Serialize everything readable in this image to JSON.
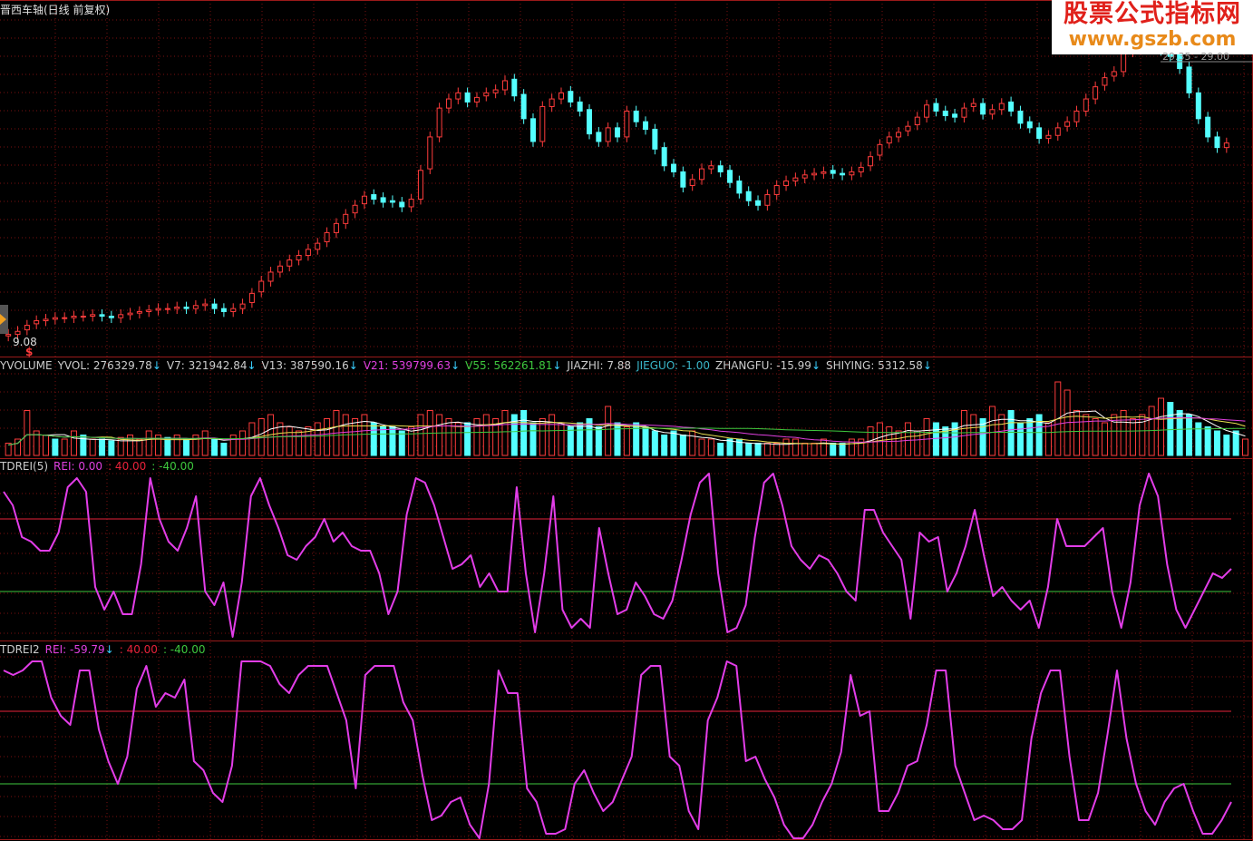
{
  "title": "晋西车轴(日线 前复权)",
  "watermark": {
    "line1": "股票公式指标网",
    "line2": "www.gszb.com"
  },
  "price_low_label": "9.08",
  "price_high_label": "29.35 - 29.00",
  "marker_label": "$",
  "colors": {
    "up": "#ff3c3c",
    "down": "#54ffff",
    "rei": "#e23de8",
    "upper": "#e8223a",
    "lower": "#3ec83e",
    "grid": "#7a1010"
  },
  "volume_header": [
    {
      "text": "YVOLUME",
      "color": "#cccccc"
    },
    {
      "text": "YVOL: 276329.78",
      "color": "#cccccc",
      "arrow": true
    },
    {
      "text": "V7: 321942.84",
      "color": "#cccccc",
      "arrow": true
    },
    {
      "text": "V13: 387590.16",
      "color": "#cccccc",
      "arrow": true
    },
    {
      "text": "V21: 539799.63",
      "color": "#e040e0",
      "arrow": true
    },
    {
      "text": "V55: 562261.81",
      "color": "#3ec83e",
      "arrow": true
    },
    {
      "text": "JIAZHI: 7.88",
      "color": "#cccccc",
      "arrow": false
    },
    {
      "text": "JIEGUO: -1.00",
      "color": "#3ab5c8",
      "arrow": false
    },
    {
      "text": "ZHANGFU: -15.99",
      "color": "#cccccc",
      "arrow": true
    },
    {
      "text": "SHIYING: 5312.58",
      "color": "#cccccc",
      "arrow": true
    }
  ],
  "tdrei_header": [
    {
      "text": "TDREI(5)",
      "color": "#cccccc"
    },
    {
      "text": "REI: 0.00",
      "color": "#e040e0"
    },
    {
      "text": ": 40.00",
      "color": "#e8223a"
    },
    {
      "text": ": -40.00",
      "color": "#3ec83e"
    }
  ],
  "tdrei2_header": [
    {
      "text": "TDREI2",
      "color": "#cccccc"
    },
    {
      "text": "REI: -59.79",
      "color": "#e040e0",
      "arrow": true
    },
    {
      "text": ": 40.00",
      "color": "#e8223a"
    },
    {
      "text": ": -40.00",
      "color": "#3ec83e"
    }
  ],
  "chart_data": [
    {
      "type": "candlestick",
      "name": "price",
      "ylim": [
        8.5,
        30
      ],
      "close": [
        9.3,
        9.5,
        9.9,
        10.2,
        10.3,
        10.4,
        10.4,
        10.5,
        10.5,
        10.6,
        10.5,
        10.4,
        10.6,
        10.7,
        10.8,
        10.9,
        11.0,
        11.0,
        11.1,
        11.0,
        11.2,
        11.3,
        11.0,
        10.8,
        11.0,
        11.3,
        12.0,
        12.8,
        13.4,
        13.8,
        14.2,
        14.5,
        14.9,
        15.3,
        16.0,
        16.6,
        17.2,
        17.8,
        18.4,
        18.2,
        18.0,
        18.0,
        17.7,
        18.2,
        20.1,
        22.3,
        24.2,
        24.8,
        25.2,
        24.6,
        24.9,
        25.2,
        25.4,
        26.0,
        25.0,
        23.5,
        22.0,
        24.3,
        24.8,
        25.2,
        24.6,
        24.0,
        22.5,
        22.0,
        22.9,
        22.3,
        24.0,
        23.3,
        22.8,
        21.5,
        20.4,
        20.0,
        19.0,
        19.5,
        20.2,
        20.4,
        20.0,
        19.3,
        18.6,
        18.1,
        17.8,
        18.5,
        19.1,
        19.4,
        19.6,
        19.8,
        19.9,
        20.0,
        19.9,
        19.8,
        20.0,
        20.3,
        21.0,
        21.8,
        22.3,
        22.6,
        23.0,
        23.6,
        24.4,
        24.0,
        23.7,
        23.6,
        24.2,
        24.5,
        23.8,
        24.1,
        24.5,
        24.0,
        23.2,
        22.9,
        22.2,
        22.4,
        22.9,
        23.3,
        24.0,
        24.8,
        25.6,
        26.2,
        26.6,
        27.8,
        28.3,
        28.7,
        28.4,
        28.0,
        27.6,
        26.8,
        25.2,
        23.5,
        22.3,
        21.6,
        21.9
      ],
      "open": [
        9.2,
        9.3,
        9.6,
        10.0,
        10.2,
        10.3,
        10.4,
        10.4,
        10.5,
        10.5,
        10.6,
        10.5,
        10.4,
        10.6,
        10.7,
        10.8,
        10.9,
        11.0,
        11.0,
        11.1,
        11.0,
        11.2,
        11.3,
        11.0,
        10.8,
        11.0,
        11.4,
        12.1,
        12.8,
        13.4,
        13.8,
        14.2,
        14.5,
        14.9,
        15.4,
        16.0,
        16.6,
        17.3,
        17.9,
        18.5,
        18.3,
        18.1,
        18.0,
        17.7,
        18.2,
        20.2,
        22.3,
        24.2,
        24.8,
        25.2,
        24.6,
        25.0,
        25.2,
        25.4,
        26.1,
        25.1,
        23.5,
        22.0,
        24.3,
        24.8,
        25.3,
        24.6,
        24.1,
        22.6,
        22.0,
        22.9,
        22.3,
        24.0,
        23.3,
        22.8,
        21.6,
        20.5,
        20.0,
        19.1,
        19.5,
        20.2,
        20.4,
        20.1,
        19.4,
        18.7,
        18.1,
        17.8,
        18.5,
        19.1,
        19.4,
        19.6,
        19.8,
        19.9,
        20.1,
        19.9,
        19.8,
        20.0,
        20.4,
        21.1,
        21.9,
        22.3,
        22.7,
        23.1,
        23.6,
        24.5,
        24.0,
        23.8,
        23.6,
        24.3,
        24.5,
        23.8,
        24.1,
        24.6,
        24.0,
        23.3,
        22.9,
        22.2,
        22.4,
        23.0,
        23.3,
        24.0,
        24.8,
        25.7,
        26.3,
        26.6,
        27.9,
        28.4,
        28.8,
        28.4,
        28.1,
        27.7,
        26.9,
        25.2,
        23.6,
        22.3,
        21.6
      ]
    },
    {
      "type": "bar",
      "name": "volume",
      "ylim": [
        0,
        1
      ],
      "values": [
        0.15,
        0.2,
        0.55,
        0.3,
        0.25,
        0.2,
        0.2,
        0.3,
        0.25,
        0.2,
        0.2,
        0.18,
        0.22,
        0.25,
        0.2,
        0.3,
        0.25,
        0.22,
        0.25,
        0.2,
        0.25,
        0.3,
        0.2,
        0.15,
        0.25,
        0.3,
        0.4,
        0.45,
        0.5,
        0.4,
        0.35,
        0.3,
        0.35,
        0.4,
        0.45,
        0.55,
        0.5,
        0.45,
        0.5,
        0.4,
        0.35,
        0.35,
        0.3,
        0.35,
        0.5,
        0.55,
        0.5,
        0.45,
        0.4,
        0.4,
        0.45,
        0.5,
        0.45,
        0.55,
        0.5,
        0.55,
        0.4,
        0.45,
        0.5,
        0.4,
        0.35,
        0.4,
        0.45,
        0.35,
        0.6,
        0.4,
        0.35,
        0.4,
        0.35,
        0.3,
        0.25,
        0.3,
        0.25,
        0.3,
        0.2,
        0.2,
        0.15,
        0.2,
        0.2,
        0.15,
        0.15,
        0.15,
        0.15,
        0.2,
        0.2,
        0.15,
        0.15,
        0.2,
        0.15,
        0.15,
        0.2,
        0.2,
        0.35,
        0.4,
        0.35,
        0.3,
        0.4,
        0.3,
        0.45,
        0.4,
        0.35,
        0.4,
        0.55,
        0.5,
        0.45,
        0.6,
        0.5,
        0.55,
        0.4,
        0.45,
        0.5,
        0.4,
        0.9,
        0.8,
        0.55,
        0.5,
        0.45,
        0.4,
        0.5,
        0.55,
        0.45,
        0.5,
        0.6,
        0.7,
        0.65,
        0.55,
        0.5,
        0.4,
        0.35,
        0.3,
        0.25,
        0.3,
        0.2
      ],
      "up": [
        true,
        true,
        true,
        true,
        true,
        false,
        true,
        true,
        false,
        true,
        false,
        false,
        true,
        true,
        true,
        true,
        true,
        false,
        true,
        false,
        true,
        true,
        false,
        false,
        true,
        true,
        true,
        true,
        true,
        true,
        true,
        true,
        true,
        true,
        true,
        true,
        true,
        true,
        true,
        false,
        false,
        false,
        false,
        true,
        true,
        true,
        true,
        true,
        true,
        false,
        true,
        true,
        true,
        true,
        false,
        false,
        false,
        true,
        true,
        true,
        false,
        false,
        false,
        false,
        true,
        false,
        true,
        false,
        false,
        false,
        false,
        false,
        false,
        true,
        true,
        true,
        false,
        false,
        false,
        false,
        false,
        true,
        true,
        true,
        true,
        true,
        true,
        true,
        false,
        false,
        true,
        true,
        true,
        true,
        true,
        true,
        true,
        true,
        true,
        false,
        false,
        false,
        true,
        true,
        false,
        true,
        true,
        false,
        false,
        false,
        false,
        true,
        true,
        true,
        true,
        true,
        true,
        true,
        true,
        true,
        true,
        true,
        true,
        true,
        false,
        false,
        false,
        false,
        false,
        false,
        false,
        false,
        true
      ]
    },
    {
      "type": "line",
      "name": "TDREI(5)",
      "ylim": [
        -90,
        90
      ],
      "reference_lines": [
        40,
        -40
      ],
      "values": [
        70,
        55,
        20,
        15,
        5,
        5,
        25,
        75,
        85,
        70,
        -35,
        -60,
        -40,
        -65,
        -65,
        -10,
        85,
        40,
        15,
        5,
        30,
        65,
        -40,
        -55,
        -30,
        -90,
        -30,
        65,
        85,
        55,
        30,
        0,
        -5,
        10,
        20,
        40,
        15,
        25,
        10,
        5,
        5,
        -20,
        -65,
        -40,
        45,
        85,
        80,
        55,
        20,
        -15,
        -10,
        0,
        -35,
        -20,
        -40,
        -40,
        75,
        -20,
        -85,
        -20,
        65,
        -60,
        -80,
        -70,
        -80,
        30,
        -20,
        -65,
        -60,
        -30,
        -45,
        -65,
        -70,
        -50,
        -5,
        45,
        80,
        90,
        -20,
        -85,
        -80,
        -55,
        20,
        80,
        90,
        55,
        10,
        -5,
        -15,
        0,
        -5,
        -20,
        -40,
        -50,
        50,
        50,
        25,
        10,
        -5,
        -70,
        25,
        15,
        20,
        -40,
        -20,
        10,
        50,
        0,
        -45,
        -35,
        -50,
        -60,
        -50,
        -80,
        -35,
        40,
        10,
        10,
        10,
        20,
        30,
        -40,
        -80,
        -30,
        55,
        90,
        65,
        -10,
        -60,
        -80,
        -60,
        -40,
        -20,
        -25,
        -15
      ]
    },
    {
      "type": "line",
      "name": "TDREI2",
      "ylim": [
        -100,
        100
      ],
      "reference_lines": [
        40,
        -40
      ],
      "values": [
        85,
        80,
        85,
        95,
        95,
        55,
        35,
        25,
        85,
        85,
        20,
        -15,
        -40,
        -10,
        65,
        90,
        45,
        60,
        55,
        75,
        -15,
        -25,
        -50,
        -60,
        -20,
        95,
        95,
        95,
        90,
        70,
        60,
        80,
        90,
        90,
        90,
        60,
        30,
        -45,
        80,
        90,
        90,
        90,
        50,
        30,
        -30,
        -80,
        -75,
        -60,
        -55,
        -85,
        -100,
        -40,
        85,
        60,
        60,
        -45,
        -60,
        -95,
        -95,
        -90,
        -40,
        -25,
        -50,
        -70,
        -60,
        -35,
        -10,
        80,
        90,
        90,
        -10,
        -20,
        -70,
        -90,
        30,
        55,
        95,
        90,
        -15,
        -10,
        -35,
        -55,
        -85,
        -100,
        -100,
        -85,
        -60,
        -40,
        -5,
        80,
        35,
        40,
        -70,
        -70,
        -50,
        -20,
        -15,
        25,
        85,
        85,
        -20,
        -50,
        -80,
        -75,
        -80,
        -90,
        -90,
        -80,
        10,
        60,
        85,
        85,
        -10,
        -80,
        -80,
        -50,
        15,
        85,
        10,
        -40,
        -70,
        -85,
        -60,
        -45,
        -40,
        -70,
        -95,
        -95,
        -80,
        -60
      ]
    }
  ]
}
